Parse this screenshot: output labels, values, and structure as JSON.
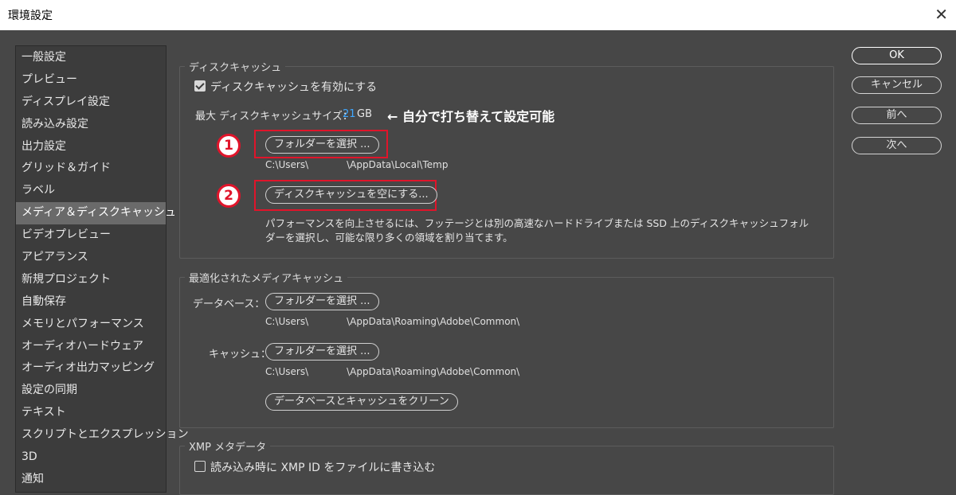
{
  "window": {
    "title": "環境設定",
    "close_glyph": "✕"
  },
  "sidebar": {
    "items": [
      {
        "label": "一般設定"
      },
      {
        "label": "プレビュー"
      },
      {
        "label": "ディスプレイ設定"
      },
      {
        "label": "読み込み設定"
      },
      {
        "label": "出力設定"
      },
      {
        "label": "グリッド＆ガイド"
      },
      {
        "label": "ラベル"
      },
      {
        "label": "メディア＆ディスクキャッシュ",
        "selected": true
      },
      {
        "label": "ビデオプレビュー"
      },
      {
        "label": "アピアランス"
      },
      {
        "label": "新規プロジェクト"
      },
      {
        "label": "自動保存"
      },
      {
        "label": "メモリとパフォーマンス"
      },
      {
        "label": "オーディオハードウェア"
      },
      {
        "label": "オーディオ出力マッピング"
      },
      {
        "label": "設定の同期"
      },
      {
        "label": "テキスト"
      },
      {
        "label": "スクリプトとエクスプレッション"
      },
      {
        "label": "3D"
      },
      {
        "label": "通知"
      }
    ]
  },
  "disk_cache": {
    "title": "ディスクキャッシュ",
    "enable_label": "ディスクキャッシュを有効にする",
    "enable_checked": true,
    "max_size_label": "最大 ディスクキャッシュサイズ：",
    "max_size_value": "21",
    "max_size_unit": "GB",
    "annotation": "← 自分で打ち替えて設定可能",
    "choose_folder_button": "フォルダーを選択 ...",
    "folder_path_prefix": "C:\\Users\\",
    "folder_path_suffix": "\\AppData\\Local\\Temp",
    "empty_cache_button": "ディスクキャッシュを空にする...",
    "badge1": "1",
    "badge2": "2",
    "description_line1": "パフォーマンスを向上させるには、フッテージとは別の高速なハードドライブまたは SSD 上のディスクキャッシュフォル",
    "description_line2": "ダーを選択し、可能な限り多くの領域を割り当てます。"
  },
  "media_cache": {
    "title": "最適化されたメディアキャッシュ",
    "database_label": "データベース：",
    "database_button": "フォルダーを選択 ...",
    "database_path_prefix": "C:\\Users\\",
    "database_path_suffix": "\\AppData\\Roaming\\Adobe\\Common\\",
    "cache_label": "キャッシュ：",
    "cache_button": "フォルダーを選択 ...",
    "cache_path_prefix": "C:\\Users\\",
    "cache_path_suffix": "\\AppData\\Roaming\\Adobe\\Common\\",
    "clean_button": "データベースとキャッシュをクリーン"
  },
  "xmp": {
    "title": "XMP メタデータ",
    "write_id_label": "読み込み時に XMP ID をファイルに書き込む",
    "write_id_checked": false
  },
  "actions": {
    "ok": "OK",
    "cancel": "キャンセル",
    "prev": "前へ",
    "next": "次へ"
  },
  "colors": {
    "accent_red": "#e0142a",
    "highlight_blue": "#40a8ff",
    "panel_bg": "#474747"
  }
}
